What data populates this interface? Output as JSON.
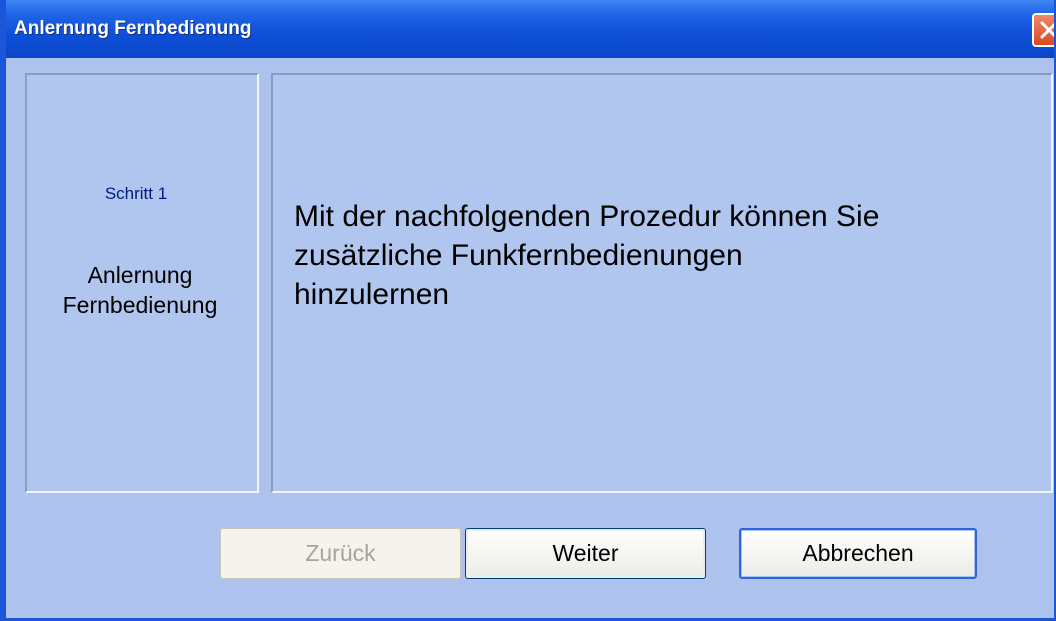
{
  "window": {
    "title": "Anlernung Fernbedienung"
  },
  "icons": {
    "close": "close-icon"
  },
  "step": {
    "label": "Schritt 1",
    "name_line1": "Anlernung",
    "name_line2": "Fernbedienung"
  },
  "message": {
    "line1": "Mit der nachfolgenden Prozedur können Sie",
    "line2": "zusätzliche Funkfernbedienungen",
    "line3": "hinzulernen"
  },
  "buttons": {
    "back": "Zurück",
    "next": "Weiter",
    "cancel": "Abbrechen"
  },
  "colors": {
    "titlebar": "#0e4fd8",
    "background": "#adc3ee",
    "step_label": "#001a80"
  }
}
